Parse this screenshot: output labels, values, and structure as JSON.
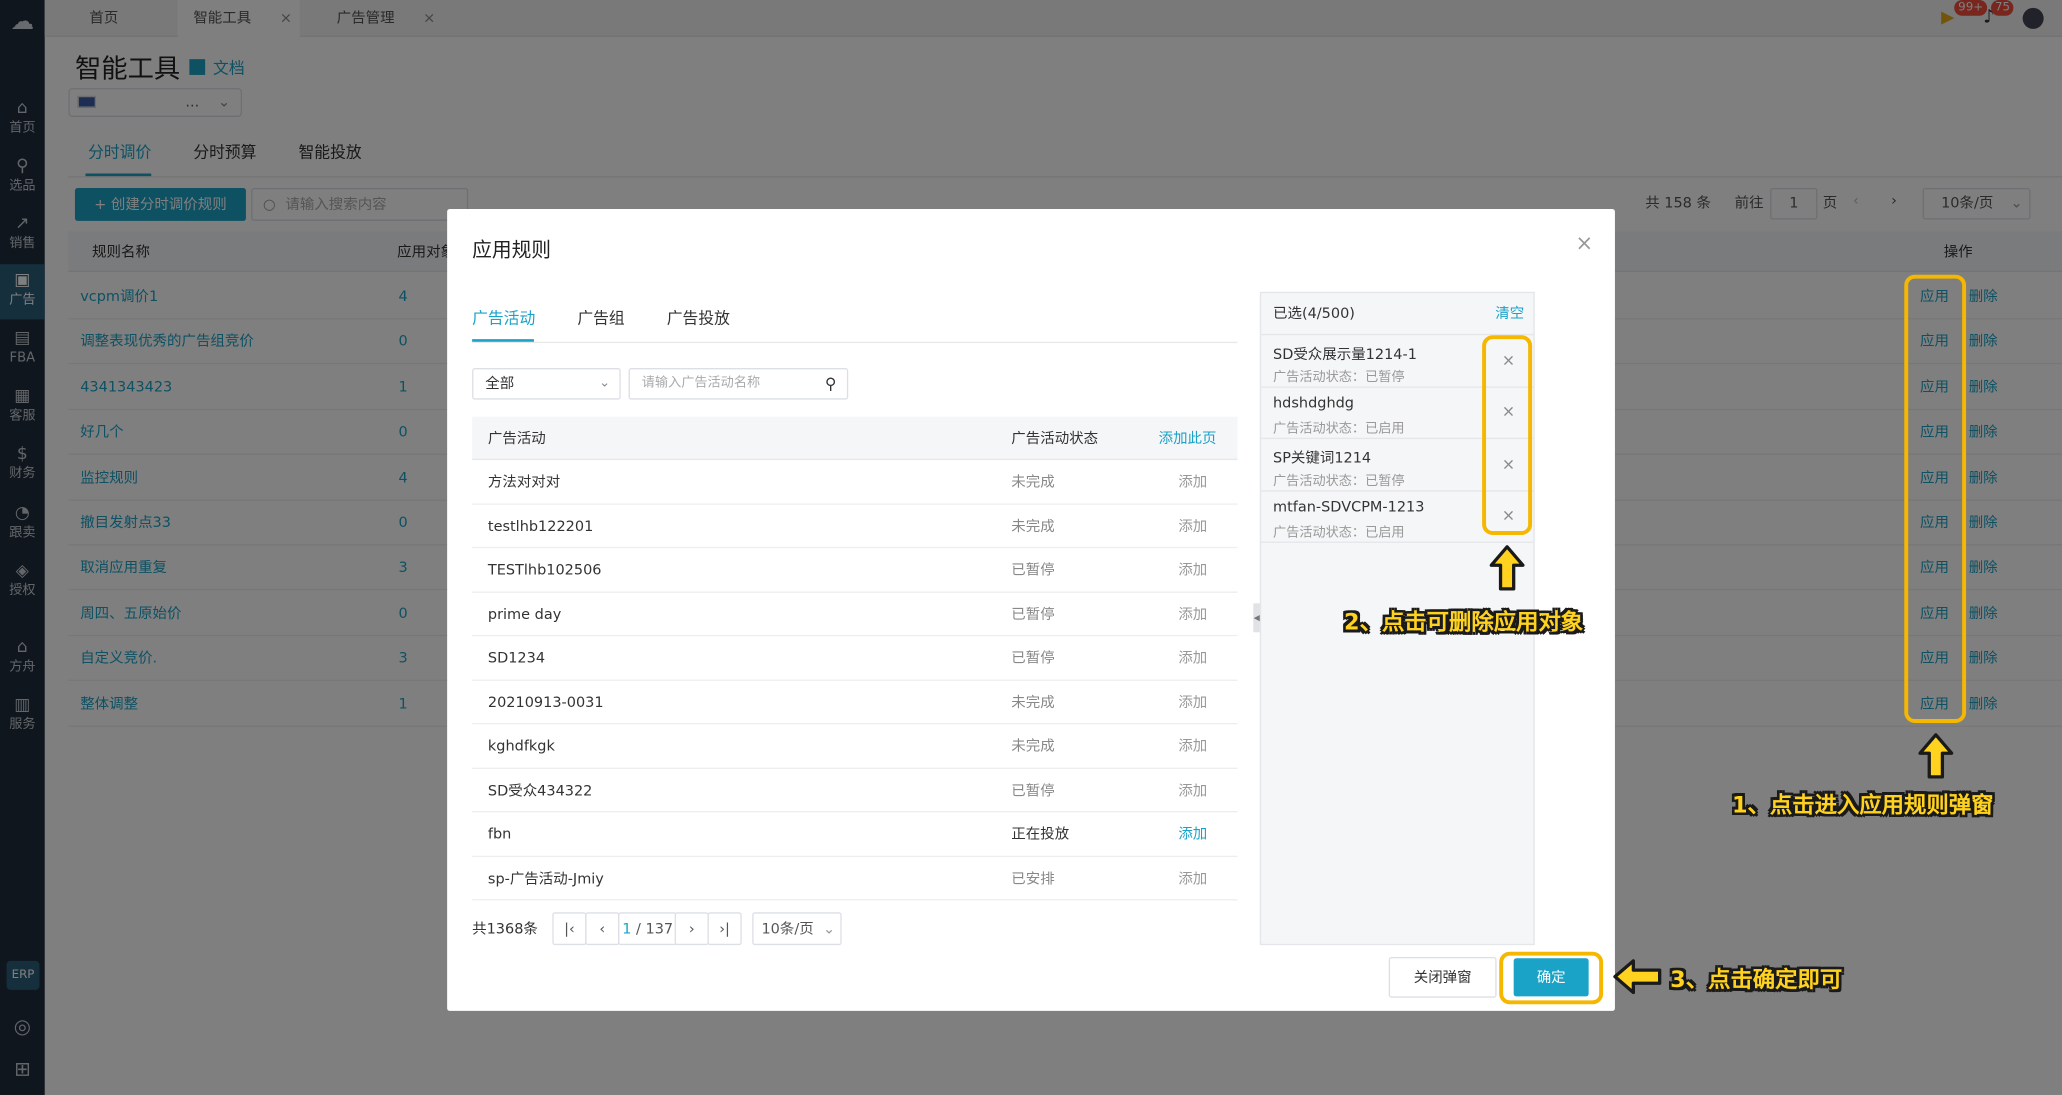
{
  "sidebar": {
    "items": [
      {
        "label": "首页",
        "icon": "home-icon",
        "glyph": "⌂"
      },
      {
        "label": "选品",
        "icon": "search-icon",
        "glyph": "⚲"
      },
      {
        "label": "销售",
        "icon": "chart-icon",
        "glyph": "↗"
      },
      {
        "label": "广告",
        "icon": "ad-icon",
        "glyph": "▣"
      },
      {
        "label": "FBA",
        "icon": "box-icon",
        "glyph": "▤"
      },
      {
        "label": "客服",
        "icon": "service-icon",
        "glyph": "▦"
      },
      {
        "label": "财务",
        "icon": "finance-icon",
        "glyph": "$"
      },
      {
        "label": "跟卖",
        "icon": "pie-icon",
        "glyph": "◔"
      },
      {
        "label": "授权",
        "icon": "shield-icon",
        "glyph": "◈"
      },
      {
        "label": "方舟",
        "icon": "ark-icon",
        "glyph": "⌂"
      },
      {
        "label": "服务",
        "icon": "store-icon",
        "glyph": "▥"
      }
    ],
    "erp": "ERP"
  },
  "page_tabs": [
    {
      "label": "首页"
    },
    {
      "label": "智能工具"
    },
    {
      "label": "广告管理"
    }
  ],
  "topright": {
    "badge1": "99+",
    "badge2": "75"
  },
  "page": {
    "title": "智能工具",
    "doc_link": "文档",
    "account": "...",
    "tabs": [
      "分时调价",
      "分时预算",
      "智能投放"
    ],
    "create_button": "+ 创建分时调价规则",
    "search_placeholder": "请输入搜索内容",
    "pager": {
      "total": "共 158 条",
      "goto": "前往",
      "page": "1",
      "page_unit": "页",
      "prev": "‹",
      "next": "›",
      "per_page": "10条/页"
    }
  },
  "table": {
    "col_name": "规则名称",
    "col_target": "应用对象",
    "col_action": "操作",
    "apply": "应用",
    "delete": "删除",
    "rows": [
      {
        "name": "vcpm调价1",
        "count": "4"
      },
      {
        "name": "调整表现优秀的广告组竞价",
        "count": "0"
      },
      {
        "name": "4341343423",
        "count": "1"
      },
      {
        "name": "好几个",
        "count": "0"
      },
      {
        "name": "监控规则",
        "count": "4"
      },
      {
        "name": "撤目发射点33",
        "count": "0"
      },
      {
        "name": "取消应用重复",
        "count": "3"
      },
      {
        "name": "周四、五原始价",
        "count": "0"
      },
      {
        "name": "自定义竞价.",
        "count": "3"
      },
      {
        "name": "整体调整",
        "count": "1"
      }
    ]
  },
  "modal": {
    "title": "应用规则",
    "close": "×",
    "tabs": [
      "广告活动",
      "广告组",
      "广告投放"
    ],
    "filter_value": "全部",
    "search_placeholder": "请输入广告活动名称",
    "col_campaign": "广告活动",
    "col_status": "广告活动状态",
    "add_page": "添加此页",
    "rows": [
      {
        "name": "方法对对对",
        "status": "未完成",
        "action": "添加"
      },
      {
        "name": "testlhb122201",
        "status": "未完成",
        "action": "添加"
      },
      {
        "name": "TESTlhb102506",
        "status": "已暂停",
        "action": "添加"
      },
      {
        "name": "prime day",
        "status": "已暂停",
        "action": "添加"
      },
      {
        "name": "SD1234",
        "status": "已暂停",
        "action": "添加"
      },
      {
        "name": "20210913-0031",
        "status": "未完成",
        "action": "添加"
      },
      {
        "name": "kghdfkgk",
        "status": "未完成",
        "action": "添加"
      },
      {
        "name": "SD受众434322",
        "status": "已暂停",
        "action": "添加"
      },
      {
        "name": "fbn",
        "status": "正在投放",
        "action": "添加"
      },
      {
        "name": "sp-广告活动-Jmiy",
        "status": "已安排",
        "action": "添加"
      }
    ],
    "pager": {
      "total": "共1368条",
      "current": "1",
      "pages": "/ 137",
      "per_page": "10条/页"
    },
    "selected": {
      "title": "已选(4/500)",
      "clear": "清空",
      "status_prefix": "广告活动状态：",
      "items": [
        {
          "name": "SD受众展示量1214-1",
          "status": "已暂停"
        },
        {
          "name": "hdshdghdg",
          "status": "已启用"
        },
        {
          "name": "SP关键词1214",
          "status": "已暂停"
        },
        {
          "name": "mtfan-SDVCPM-1213",
          "status": "已启用"
        }
      ]
    },
    "cancel": "关闭弹窗",
    "confirm": "确定"
  },
  "annotations": {
    "a1": "1、点击进入应用规则弹窗",
    "a2": "2、点击可删除应用对象",
    "a3": "3、点击确定即可"
  },
  "colors": {
    "accent": "#1aa2c7",
    "highlight": "#f5b700",
    "sidebar": "#1f2d3d"
  }
}
